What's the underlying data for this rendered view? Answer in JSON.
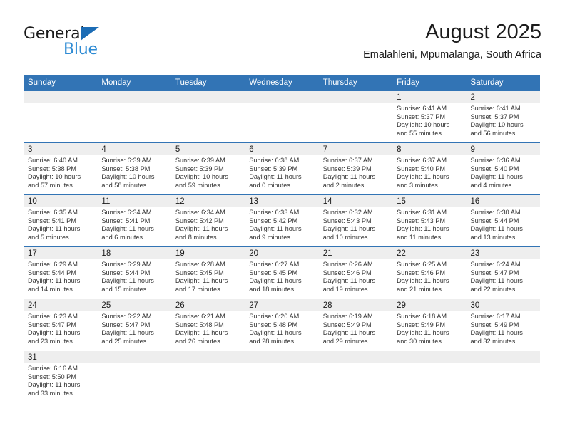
{
  "logo": {
    "word1": "General",
    "word2": "Blue",
    "triangle_color": "#1b6cb5",
    "blue_text_color": "#2e8bd4"
  },
  "header": {
    "month_title": "August 2025",
    "location": "Emalahleni, Mpumalanga, South Africa"
  },
  "theme": {
    "header_blue": "#3274b5",
    "day_band_gray": "#eeeeee",
    "text_dark": "#1b1b1b",
    "detail_gray": "#333333"
  },
  "calendar": {
    "weekday_headers": [
      "Sunday",
      "Monday",
      "Tuesday",
      "Wednesday",
      "Thursday",
      "Friday",
      "Saturday"
    ],
    "weeks": [
      [
        {
          "day": "",
          "sunrise": "",
          "sunset": "",
          "daylight_line1": "",
          "daylight_line2": "",
          "empty": true
        },
        {
          "day": "",
          "sunrise": "",
          "sunset": "",
          "daylight_line1": "",
          "daylight_line2": "",
          "empty": true
        },
        {
          "day": "",
          "sunrise": "",
          "sunset": "",
          "daylight_line1": "",
          "daylight_line2": "",
          "empty": true
        },
        {
          "day": "",
          "sunrise": "",
          "sunset": "",
          "daylight_line1": "",
          "daylight_line2": "",
          "empty": true
        },
        {
          "day": "",
          "sunrise": "",
          "sunset": "",
          "daylight_line1": "",
          "daylight_line2": "",
          "empty": true
        },
        {
          "day": "1",
          "sunrise": "Sunrise: 6:41 AM",
          "sunset": "Sunset: 5:37 PM",
          "daylight_line1": "Daylight: 10 hours",
          "daylight_line2": "and 55 minutes."
        },
        {
          "day": "2",
          "sunrise": "Sunrise: 6:41 AM",
          "sunset": "Sunset: 5:37 PM",
          "daylight_line1": "Daylight: 10 hours",
          "daylight_line2": "and 56 minutes."
        }
      ],
      [
        {
          "day": "3",
          "sunrise": "Sunrise: 6:40 AM",
          "sunset": "Sunset: 5:38 PM",
          "daylight_line1": "Daylight: 10 hours",
          "daylight_line2": "and 57 minutes."
        },
        {
          "day": "4",
          "sunrise": "Sunrise: 6:39 AM",
          "sunset": "Sunset: 5:38 PM",
          "daylight_line1": "Daylight: 10 hours",
          "daylight_line2": "and 58 minutes."
        },
        {
          "day": "5",
          "sunrise": "Sunrise: 6:39 AM",
          "sunset": "Sunset: 5:39 PM",
          "daylight_line1": "Daylight: 10 hours",
          "daylight_line2": "and 59 minutes."
        },
        {
          "day": "6",
          "sunrise": "Sunrise: 6:38 AM",
          "sunset": "Sunset: 5:39 PM",
          "daylight_line1": "Daylight: 11 hours",
          "daylight_line2": "and 0 minutes."
        },
        {
          "day": "7",
          "sunrise": "Sunrise: 6:37 AM",
          "sunset": "Sunset: 5:39 PM",
          "daylight_line1": "Daylight: 11 hours",
          "daylight_line2": "and 2 minutes."
        },
        {
          "day": "8",
          "sunrise": "Sunrise: 6:37 AM",
          "sunset": "Sunset: 5:40 PM",
          "daylight_line1": "Daylight: 11 hours",
          "daylight_line2": "and 3 minutes."
        },
        {
          "day": "9",
          "sunrise": "Sunrise: 6:36 AM",
          "sunset": "Sunset: 5:40 PM",
          "daylight_line1": "Daylight: 11 hours",
          "daylight_line2": "and 4 minutes."
        }
      ],
      [
        {
          "day": "10",
          "sunrise": "Sunrise: 6:35 AM",
          "sunset": "Sunset: 5:41 PM",
          "daylight_line1": "Daylight: 11 hours",
          "daylight_line2": "and 5 minutes."
        },
        {
          "day": "11",
          "sunrise": "Sunrise: 6:34 AM",
          "sunset": "Sunset: 5:41 PM",
          "daylight_line1": "Daylight: 11 hours",
          "daylight_line2": "and 6 minutes."
        },
        {
          "day": "12",
          "sunrise": "Sunrise: 6:34 AM",
          "sunset": "Sunset: 5:42 PM",
          "daylight_line1": "Daylight: 11 hours",
          "daylight_line2": "and 8 minutes."
        },
        {
          "day": "13",
          "sunrise": "Sunrise: 6:33 AM",
          "sunset": "Sunset: 5:42 PM",
          "daylight_line1": "Daylight: 11 hours",
          "daylight_line2": "and 9 minutes."
        },
        {
          "day": "14",
          "sunrise": "Sunrise: 6:32 AM",
          "sunset": "Sunset: 5:43 PM",
          "daylight_line1": "Daylight: 11 hours",
          "daylight_line2": "and 10 minutes."
        },
        {
          "day": "15",
          "sunrise": "Sunrise: 6:31 AM",
          "sunset": "Sunset: 5:43 PM",
          "daylight_line1": "Daylight: 11 hours",
          "daylight_line2": "and 11 minutes."
        },
        {
          "day": "16",
          "sunrise": "Sunrise: 6:30 AM",
          "sunset": "Sunset: 5:44 PM",
          "daylight_line1": "Daylight: 11 hours",
          "daylight_line2": "and 13 minutes."
        }
      ],
      [
        {
          "day": "17",
          "sunrise": "Sunrise: 6:29 AM",
          "sunset": "Sunset: 5:44 PM",
          "daylight_line1": "Daylight: 11 hours",
          "daylight_line2": "and 14 minutes."
        },
        {
          "day": "18",
          "sunrise": "Sunrise: 6:29 AM",
          "sunset": "Sunset: 5:44 PM",
          "daylight_line1": "Daylight: 11 hours",
          "daylight_line2": "and 15 minutes."
        },
        {
          "day": "19",
          "sunrise": "Sunrise: 6:28 AM",
          "sunset": "Sunset: 5:45 PM",
          "daylight_line1": "Daylight: 11 hours",
          "daylight_line2": "and 17 minutes."
        },
        {
          "day": "20",
          "sunrise": "Sunrise: 6:27 AM",
          "sunset": "Sunset: 5:45 PM",
          "daylight_line1": "Daylight: 11 hours",
          "daylight_line2": "and 18 minutes."
        },
        {
          "day": "21",
          "sunrise": "Sunrise: 6:26 AM",
          "sunset": "Sunset: 5:46 PM",
          "daylight_line1": "Daylight: 11 hours",
          "daylight_line2": "and 19 minutes."
        },
        {
          "day": "22",
          "sunrise": "Sunrise: 6:25 AM",
          "sunset": "Sunset: 5:46 PM",
          "daylight_line1": "Daylight: 11 hours",
          "daylight_line2": "and 21 minutes."
        },
        {
          "day": "23",
          "sunrise": "Sunrise: 6:24 AM",
          "sunset": "Sunset: 5:47 PM",
          "daylight_line1": "Daylight: 11 hours",
          "daylight_line2": "and 22 minutes."
        }
      ],
      [
        {
          "day": "24",
          "sunrise": "Sunrise: 6:23 AM",
          "sunset": "Sunset: 5:47 PM",
          "daylight_line1": "Daylight: 11 hours",
          "daylight_line2": "and 23 minutes."
        },
        {
          "day": "25",
          "sunrise": "Sunrise: 6:22 AM",
          "sunset": "Sunset: 5:47 PM",
          "daylight_line1": "Daylight: 11 hours",
          "daylight_line2": "and 25 minutes."
        },
        {
          "day": "26",
          "sunrise": "Sunrise: 6:21 AM",
          "sunset": "Sunset: 5:48 PM",
          "daylight_line1": "Daylight: 11 hours",
          "daylight_line2": "and 26 minutes."
        },
        {
          "day": "27",
          "sunrise": "Sunrise: 6:20 AM",
          "sunset": "Sunset: 5:48 PM",
          "daylight_line1": "Daylight: 11 hours",
          "daylight_line2": "and 28 minutes."
        },
        {
          "day": "28",
          "sunrise": "Sunrise: 6:19 AM",
          "sunset": "Sunset: 5:49 PM",
          "daylight_line1": "Daylight: 11 hours",
          "daylight_line2": "and 29 minutes."
        },
        {
          "day": "29",
          "sunrise": "Sunrise: 6:18 AM",
          "sunset": "Sunset: 5:49 PM",
          "daylight_line1": "Daylight: 11 hours",
          "daylight_line2": "and 30 minutes."
        },
        {
          "day": "30",
          "sunrise": "Sunrise: 6:17 AM",
          "sunset": "Sunset: 5:49 PM",
          "daylight_line1": "Daylight: 11 hours",
          "daylight_line2": "and 32 minutes."
        }
      ],
      [
        {
          "day": "31",
          "sunrise": "Sunrise: 6:16 AM",
          "sunset": "Sunset: 5:50 PM",
          "daylight_line1": "Daylight: 11 hours",
          "daylight_line2": "and 33 minutes."
        },
        {
          "day": "",
          "sunrise": "",
          "sunset": "",
          "daylight_line1": "",
          "daylight_line2": "",
          "blank": true
        },
        {
          "day": "",
          "sunrise": "",
          "sunset": "",
          "daylight_line1": "",
          "daylight_line2": "",
          "blank": true
        },
        {
          "day": "",
          "sunrise": "",
          "sunset": "",
          "daylight_line1": "",
          "daylight_line2": "",
          "blank": true
        },
        {
          "day": "",
          "sunrise": "",
          "sunset": "",
          "daylight_line1": "",
          "daylight_line2": "",
          "blank": true
        },
        {
          "day": "",
          "sunrise": "",
          "sunset": "",
          "daylight_line1": "",
          "daylight_line2": "",
          "blank": true
        },
        {
          "day": "",
          "sunrise": "",
          "sunset": "",
          "daylight_line1": "",
          "daylight_line2": "",
          "blank": true
        }
      ]
    ]
  }
}
